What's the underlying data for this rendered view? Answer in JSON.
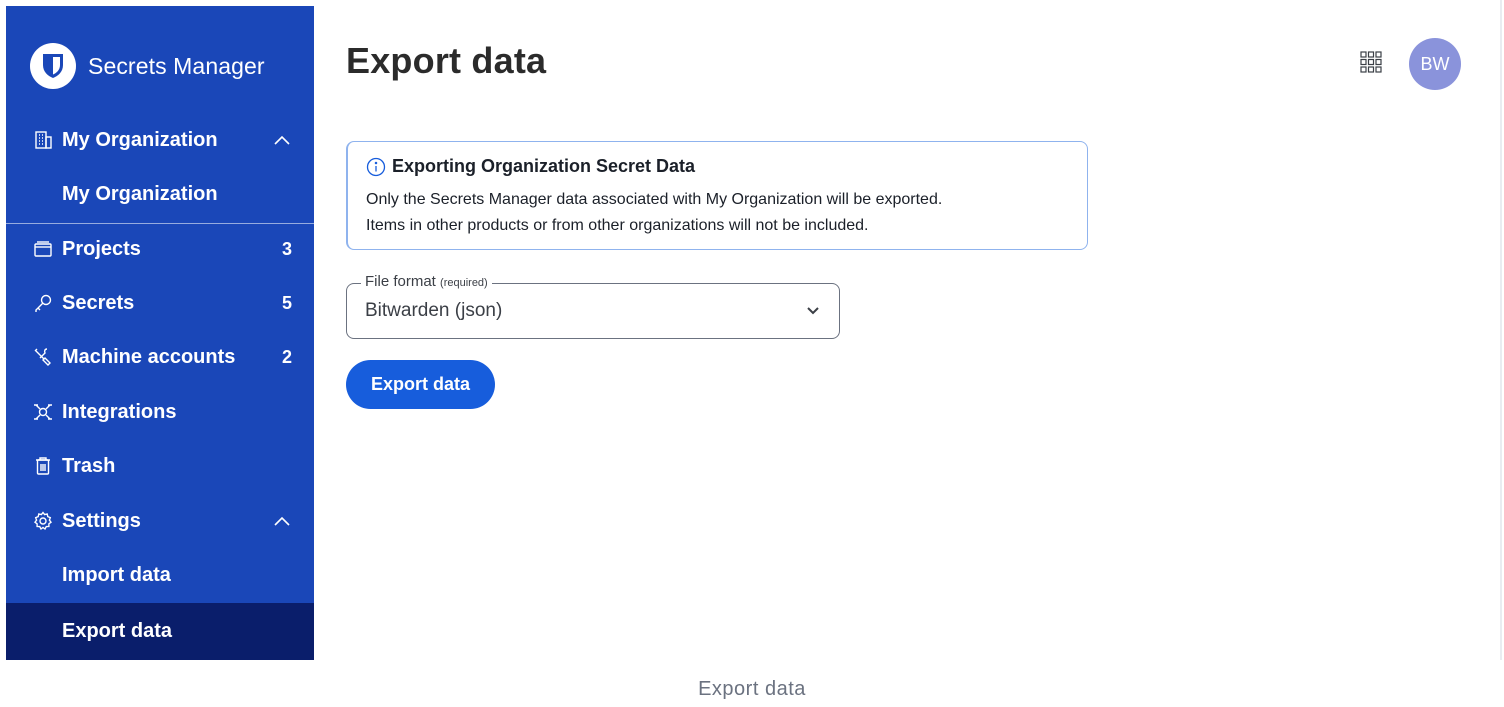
{
  "app": {
    "brand_name": "Secrets Manager"
  },
  "sidebar": {
    "org_header": {
      "label": "My Organization",
      "icon": "building-icon"
    },
    "org_sub": {
      "label": "My Organization"
    },
    "items": [
      {
        "label": "Projects",
        "count": "3",
        "icon": "projects-icon"
      },
      {
        "label": "Secrets",
        "count": "5",
        "icon": "key-icon"
      },
      {
        "label": "Machine accounts",
        "count": "2",
        "icon": "wrench-icon"
      },
      {
        "label": "Integrations",
        "count": "",
        "icon": "integrations-icon"
      },
      {
        "label": "Trash",
        "count": "",
        "icon": "trash-icon"
      }
    ],
    "settings": {
      "label": "Settings",
      "icon": "gear-icon"
    },
    "settings_sub": [
      {
        "label": "Import data"
      },
      {
        "label": "Export data",
        "active": true
      }
    ]
  },
  "header": {
    "title": "Export data",
    "avatar_initials": "BW"
  },
  "callout": {
    "title": "Exporting Organization Secret Data",
    "line1": "Only the Secrets Manager data associated with My Organization will be exported.",
    "line2": "Items in other products or from other organizations will not be included."
  },
  "form": {
    "file_format_label": "File format",
    "required_text": "(required)",
    "file_format_value": "Bitwarden (json)"
  },
  "actions": {
    "export_label": "Export data"
  },
  "caption": "Export data",
  "colors": {
    "sidebar_bg": "#1a47b8",
    "sidebar_active": "#0a1e6b",
    "primary": "#175ddc",
    "avatar_bg": "#8a93db"
  }
}
